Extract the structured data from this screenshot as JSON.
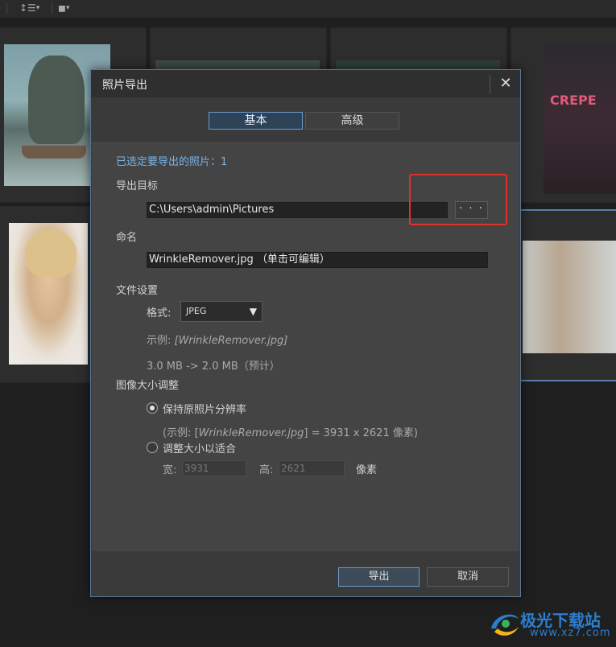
{
  "toolbar": {
    "sort_icon_glyph": "↕☰",
    "stack_icon_glyph": "◼",
    "caret": "▾"
  },
  "dialog": {
    "title": "照片导出",
    "close_glyph": "✕",
    "tabs": [
      {
        "label": "基本",
        "active": true
      },
      {
        "label": "高级",
        "active": false
      }
    ],
    "selected_count_label": "已选定要导出的照片：1",
    "export_target": {
      "label": "导出目标",
      "path": "C:\\Users\\admin\\Pictures",
      "browse_label": "· · ·"
    },
    "naming": {
      "label": "命名",
      "value": "WrinkleRemover.jpg  （单击可编辑）"
    },
    "file_settings": {
      "label": "文件设置",
      "format_label": "格式:",
      "format_value": "JPEG",
      "format_arrow": "▼",
      "example_label": "示例:",
      "example_value": "[WrinkleRemover.jpg]",
      "size_estimate": "3.0 MB -> 2.0 MB（预计）"
    },
    "resize": {
      "label": "图像大小调整",
      "keep_original_label": "保持原照片分辨率",
      "keep_original_selected": true,
      "example_prefix": "(示例: [",
      "example_file": "WrinkleRemover.jpg",
      "example_suffix": "] = 3931 x 2621 像素)",
      "fit_label": "调整大小以适合",
      "fit_selected": false,
      "width_label": "宽:",
      "width_value": "3931",
      "height_label": "高:",
      "height_value": "2621",
      "unit_label": "像素"
    },
    "buttons": {
      "export_label": "导出",
      "cancel_label": "取消"
    }
  },
  "watermark": {
    "text": "极光下载站",
    "url": "www.xz7.com"
  },
  "colors": {
    "accent": "#6a9ccd",
    "highlight_red": "#e0302c",
    "info_blue": "#79b3e6"
  }
}
